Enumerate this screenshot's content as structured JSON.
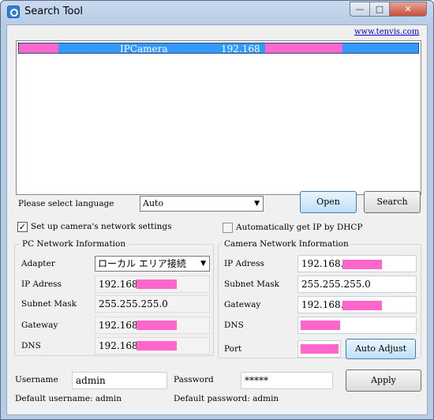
{
  "window": {
    "title": "Search Tool",
    "min_glyph": "—",
    "max_glyph": "□",
    "close_glyph": "✕"
  },
  "header": {
    "link": "www.tenvis.com"
  },
  "device_list": {
    "selected_row": {
      "name": "IPCamera",
      "ip_prefix": "192.168"
    }
  },
  "language": {
    "label": "Please select language",
    "value": "Auto",
    "arrow": "▼"
  },
  "buttons": {
    "open": "Open",
    "search": "Search",
    "auto_adjust": "Auto Adjust",
    "apply": "Apply"
  },
  "options": {
    "setup_network": {
      "label": "Set up camera's network settings",
      "checked": true,
      "mark": "✓"
    },
    "auto_dhcp": {
      "label": "Automatically get IP by DHCP",
      "checked": false
    }
  },
  "pc_network": {
    "title": "PC Network Information",
    "adapter_label": "Adapter",
    "adapter_value": "ローカル エリア接続",
    "ip_label": "IP Adress",
    "ip_value": "192.168",
    "subnet_label": "Subnet Mask",
    "subnet_value": "255.255.255.0",
    "gateway_label": "Gateway",
    "gateway_value": "192.168",
    "dns_label": "DNS",
    "dns_value": "192.168"
  },
  "camera_network": {
    "title": "Camera Network Information",
    "ip_label": "IP Adress",
    "ip_value": "192.168.",
    "subnet_label": "Subnet Mask",
    "subnet_value": "255.255.255.0",
    "gateway_label": "Gateway",
    "gateway_value": "192.168.",
    "dns_label": "DNS",
    "port_label": "Port"
  },
  "credentials": {
    "username_label": "Username",
    "username_value": "admin",
    "password_label": "Password",
    "password_value": "*****",
    "default_username": "Default username: admin",
    "default_password": "Default password: admin"
  },
  "colors": {
    "selection": "#3399ff",
    "redaction": "#ff66cc",
    "link": "#0000cc"
  }
}
